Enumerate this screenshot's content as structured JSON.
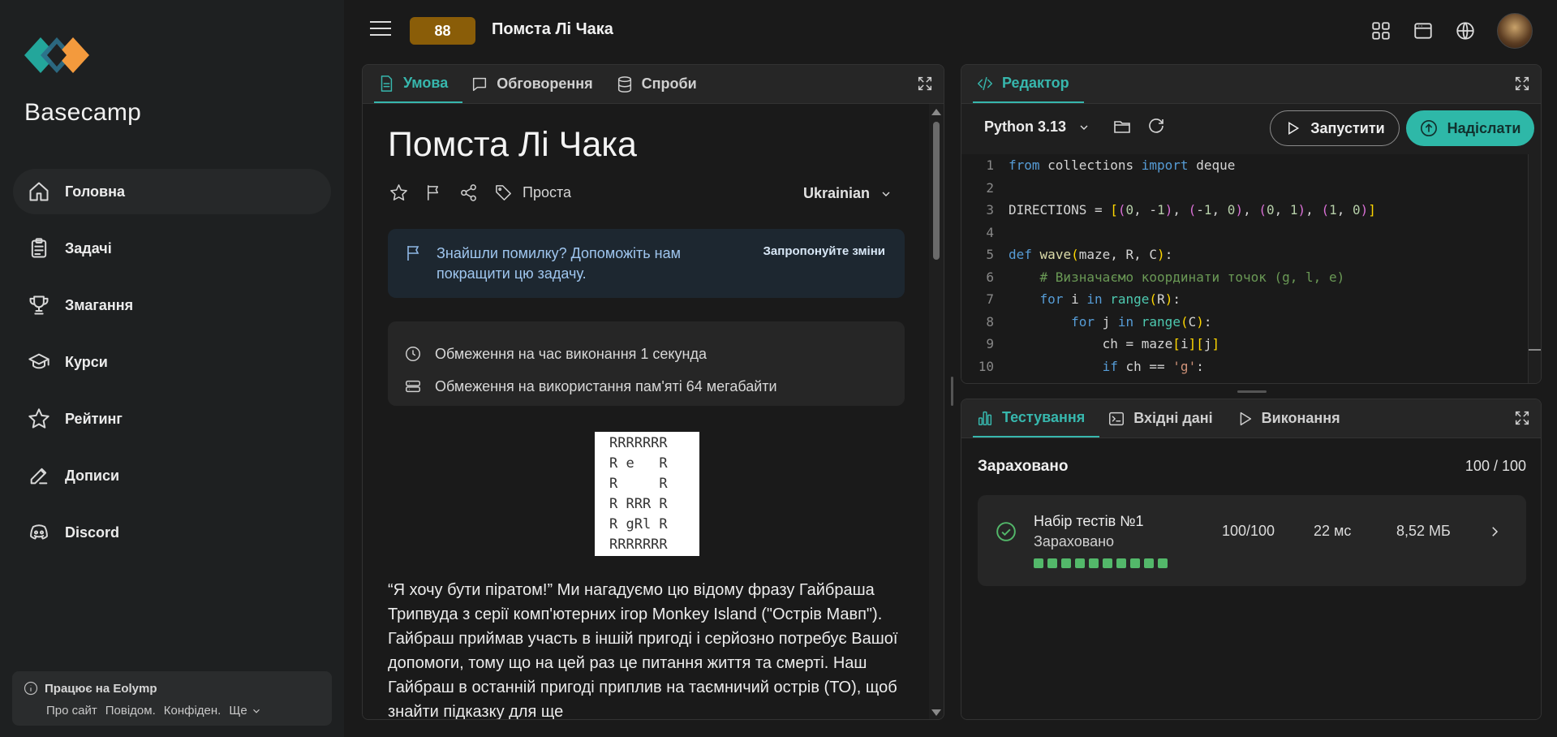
{
  "sidebar": {
    "brand": "Basecamp",
    "items": [
      {
        "label": "Головна",
        "icon": "home-icon"
      },
      {
        "label": "Задачі",
        "icon": "clipboard-icon"
      },
      {
        "label": "Змагання",
        "icon": "trophy-icon"
      },
      {
        "label": "Курси",
        "icon": "graduation-cap-icon"
      },
      {
        "label": "Рейтинг",
        "icon": "star-icon"
      },
      {
        "label": "Дописи",
        "icon": "edit-icon"
      },
      {
        "label": "Discord",
        "icon": "discord-icon"
      }
    ],
    "footer": {
      "title": "Працює на Eolymp",
      "links": [
        "Про сайт",
        "Повідом.",
        "Конфіден.",
        "Ще"
      ]
    }
  },
  "header": {
    "badge": "88",
    "title": "Помста Лі Чака"
  },
  "problem_panel": {
    "tabs": [
      "Умова",
      "Обговорення",
      "Спроби"
    ],
    "title": "Помста Лі Чака",
    "difficulty": "Проста",
    "language": "Ukrainian",
    "notice_text": "Знайшли помилку? Допоможіть нам покращити цю задачу.",
    "notice_link": "Запропонуйте зміни",
    "time_limit": "Обмеження на час виконання 1 секунда",
    "memory_limit": "Обмеження на використання пам'яті 64 мегабайти",
    "maze_lines": [
      "RRRRRRR",
      "R e   R",
      "R     R",
      "R RRR R",
      "R gRl R",
      "RRRRRRR"
    ],
    "statement": "“Я хочу бути піратом!” Ми нагадуємо цю відому фразу Гайбраша Трипвуда з серії комп'ютерних ігор Monkey Island (\"Острів Мавп\"). Гайбраш приймав участь в іншій пригоді і серйозно потребує Вашої допомоги, тому що на цей раз це питання життя та смерті. Наш Гайбраш в останній пригоді приплив на таємничий острів (ТО), щоб знайти підказку для ще"
  },
  "editor_panel": {
    "tab": "Редактор",
    "language": "Python 3.13",
    "run_label": "Запустити",
    "submit_label": "Надіслати",
    "code_lines": [
      "from collections import deque",
      "",
      "DIRECTIONS = [(0, -1), (-1, 0), (0, 1), (1, 0)]",
      "",
      "def wave(maze, R, C):",
      "    # Визначаємо координати точок (g, l, e)",
      "    for i in range(R):",
      "        for j in range(C):",
      "            ch = maze[i][j]",
      "            if ch == 'g':"
    ]
  },
  "test_panel": {
    "tabs": [
      "Тестування",
      "Вхідні дані",
      "Виконання"
    ],
    "verdict": "Зараховано",
    "score": "100 / 100",
    "test_set": {
      "name": "Набір тестів №1",
      "status": "Зараховано",
      "points": "100/100",
      "time": "22 мс",
      "memory": "8,52 МБ",
      "passed_tests": 10,
      "total_tests": 10
    }
  },
  "colors": {
    "accent": "#37b7ad",
    "badge": "#8a5d08",
    "success": "#53b86a"
  }
}
